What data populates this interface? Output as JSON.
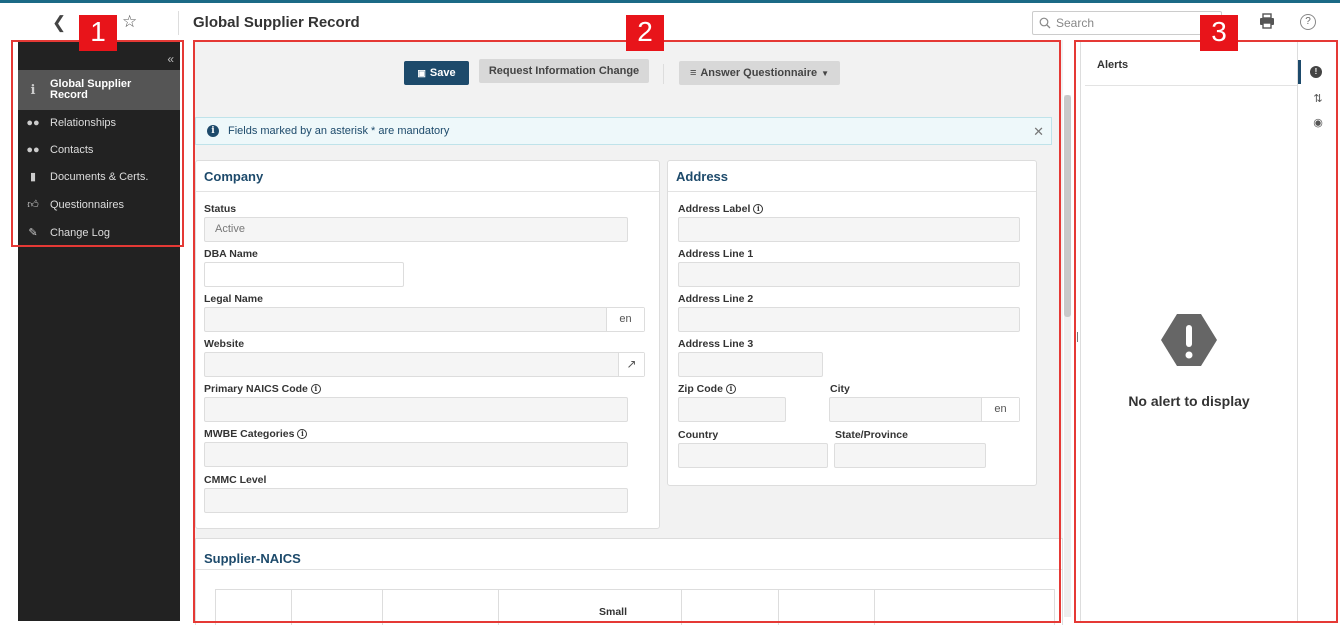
{
  "header": {
    "title": "Global Supplier Record",
    "search_placeholder": "Search"
  },
  "sidebar": {
    "items": [
      {
        "label": "Global Supplier Record",
        "icon": "info-icon"
      },
      {
        "label": "Relationships",
        "icon": "people-icon"
      },
      {
        "label": "Contacts",
        "icon": "people-icon"
      },
      {
        "label": "Documents & Certs.",
        "icon": "document-icon"
      },
      {
        "label": "Questionnaires",
        "icon": "thumbs-up-icon"
      },
      {
        "label": "Change Log",
        "icon": "edit-icon"
      }
    ]
  },
  "toolbar": {
    "save_label": "Save",
    "request_change_label": "Request Information Change",
    "answer_questionnaire_label": "Answer Questionnaire"
  },
  "notice": {
    "text": "Fields marked by an asterisk * are mandatory"
  },
  "company": {
    "title": "Company",
    "status_label": "Status",
    "status_value": "Active",
    "dba_label": "DBA Name",
    "legal_label": "Legal Name",
    "legal_suffix": "en",
    "website_label": "Website",
    "naics_label": "Primary NAICS Code",
    "mwbe_label": "MWBE Categories",
    "cmmc_label": "CMMC Level"
  },
  "address": {
    "title": "Address",
    "label_label": "Address Label",
    "line1_label": "Address Line 1",
    "line2_label": "Address Line 2",
    "line3_label": "Address Line 3",
    "zip_label": "Zip Code",
    "city_label": "City",
    "city_suffix": "en",
    "country_label": "Country",
    "state_label": "State/Province"
  },
  "supplier_naics": {
    "title": "Supplier-NAICS",
    "column_small": "Small"
  },
  "alerts": {
    "title": "Alerts",
    "empty_text": "No alert to display"
  },
  "annotations": [
    "1",
    "2",
    "3"
  ],
  "colors": {
    "accent": "#1d4a6b",
    "annotation_red": "#e53935",
    "sidebar_bg": "#222222"
  }
}
